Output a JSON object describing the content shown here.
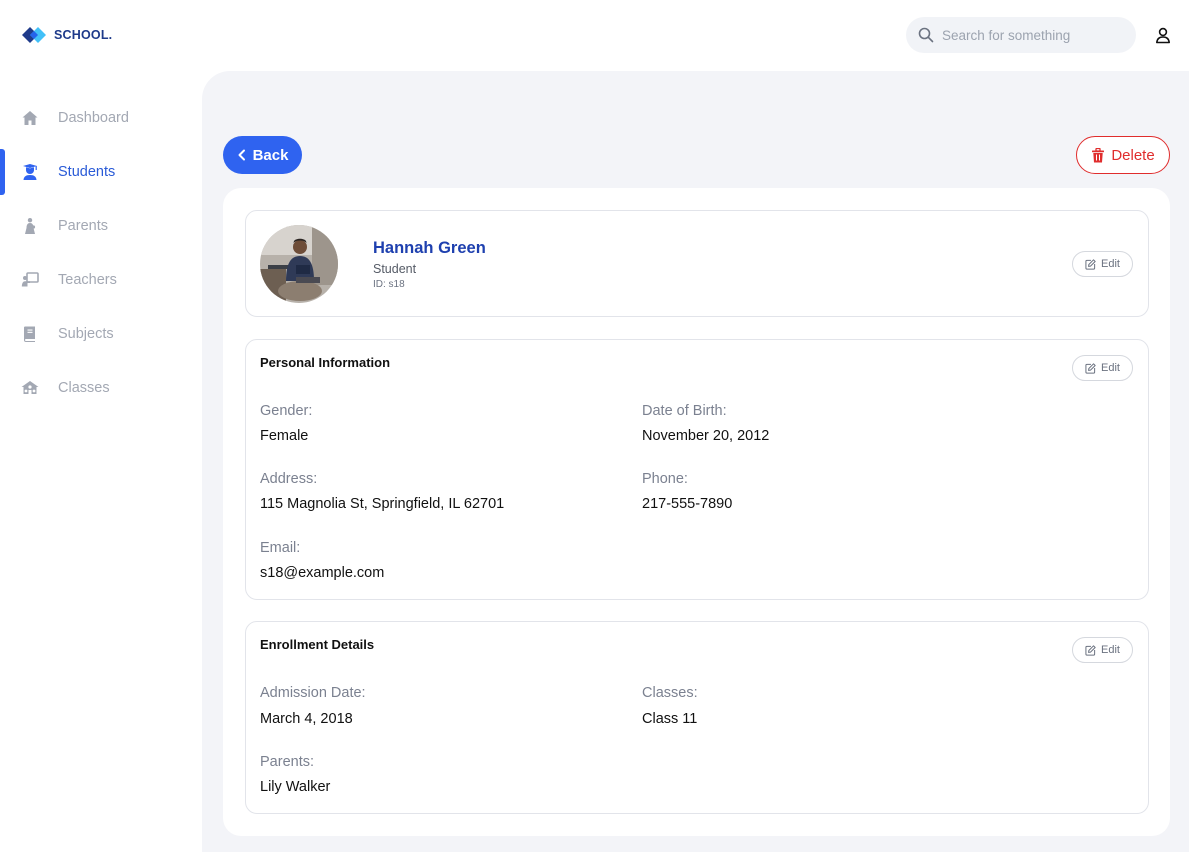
{
  "app": {
    "brand": "SCHOOL."
  },
  "search": {
    "placeholder": "Search for something",
    "value": ""
  },
  "sidebar": {
    "items": [
      {
        "label": "Dashboard",
        "icon": "home-icon",
        "active": false
      },
      {
        "label": "Students",
        "icon": "graduation-cap-icon",
        "active": true
      },
      {
        "label": "Parents",
        "icon": "parent-child-icon",
        "active": false
      },
      {
        "label": "Teachers",
        "icon": "chalkboard-teacher-icon",
        "active": false
      },
      {
        "label": "Subjects",
        "icon": "book-icon",
        "active": false
      },
      {
        "label": "Classes",
        "icon": "school-building-icon",
        "active": false
      }
    ]
  },
  "actions": {
    "back_label": "Back",
    "delete_label": "Delete"
  },
  "profile": {
    "name": "Hannah Green",
    "role": "Student",
    "id": "ID: s18",
    "edit_label": "Edit"
  },
  "personal": {
    "title": "Personal Information",
    "edit_label": "Edit",
    "gender_label": "Gender:",
    "gender": "Female",
    "dob_label": "Date of Birth:",
    "dob": "November 20, 2012",
    "address_label": "Address:",
    "address": "115 Magnolia St, Springfield, IL 62701",
    "phone_label": "Phone:",
    "phone": "217-555-7890",
    "email_label": "Email:",
    "email": "s18@example.com"
  },
  "enrollment": {
    "title": "Enrollment Details",
    "edit_label": "Edit",
    "admission_label": "Admission Date:",
    "admission": "March 4, 2018",
    "classes_label": "Classes:",
    "classes": "Class 11",
    "parents_label": "Parents:",
    "parents": "Lily Walker"
  },
  "colors": {
    "accent": "#2f63f0",
    "danger": "#e02d2d",
    "name": "#1e40af",
    "background": "#f3f4f8"
  }
}
